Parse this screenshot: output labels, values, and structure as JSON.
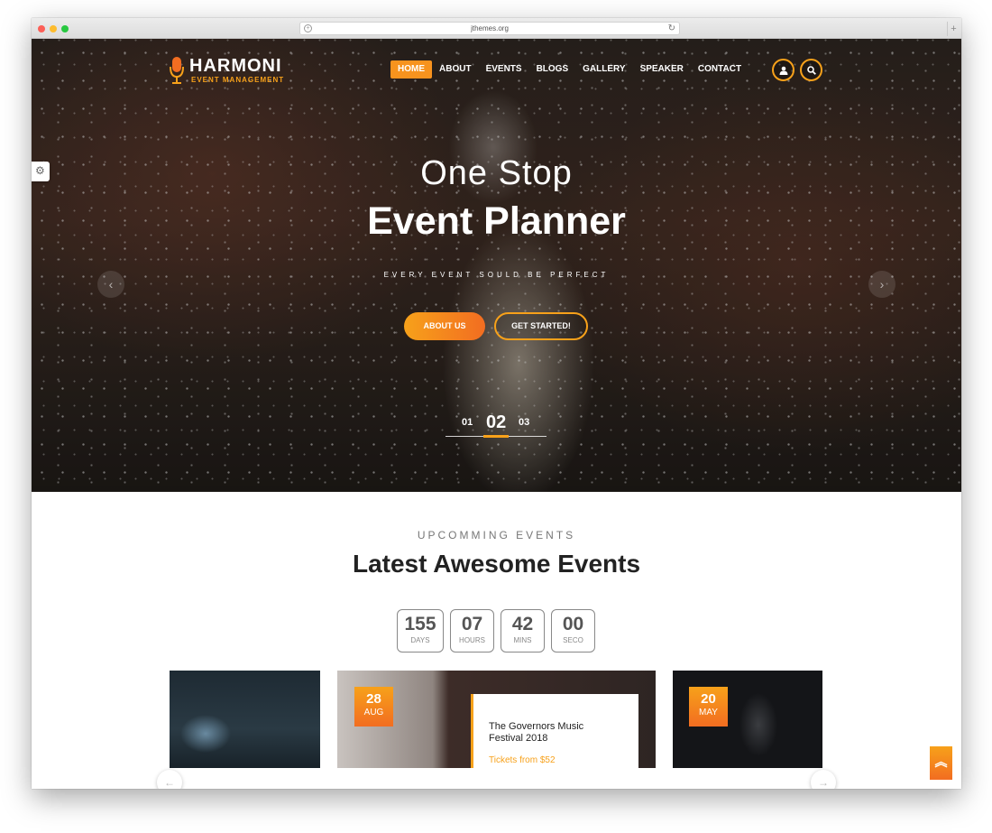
{
  "browser": {
    "url": "jthemes.org"
  },
  "brand": {
    "name": "HARMONI",
    "subtitle": "EVENT MANAGEMENT"
  },
  "nav": {
    "items": [
      {
        "label": "HOME",
        "active": true
      },
      {
        "label": "ABOUT",
        "active": false
      },
      {
        "label": "EVENTS",
        "active": false
      },
      {
        "label": "BLOGS",
        "active": false
      },
      {
        "label": "GALLERY",
        "active": false
      },
      {
        "label": "SPEAKER",
        "active": false
      },
      {
        "label": "CONTACT",
        "active": false
      }
    ]
  },
  "hero": {
    "title_line1": "One Stop",
    "title_line2": "Event Planner",
    "tagline": "EVERY EVENT SOULD BE PERFECT",
    "btn_about": "ABOUT US",
    "btn_start": "GET STARTED!",
    "slides": [
      "01",
      "02",
      "03"
    ],
    "active_slide": "02"
  },
  "events_section": {
    "subtitle": "UPCOMMING EVENTS",
    "title_light": "Latest",
    "title_bold": "Awesome Events"
  },
  "countdown": [
    {
      "value": "155",
      "label": "DAYS"
    },
    {
      "value": "07",
      "label": "HOURS"
    },
    {
      "value": "42",
      "label": "MINS"
    },
    {
      "value": "00",
      "label": "SECO"
    }
  ],
  "cards": [
    {
      "day": "28",
      "month": "AUG",
      "name": "The Governors Music Festival 2018",
      "price": "Tickets from $52"
    },
    {
      "day": "20",
      "month": "MAY"
    }
  ],
  "colors": {
    "accent": "#f7a11a",
    "accent_dark": "#f26d21"
  },
  "icons": {
    "user": "user-icon",
    "search": "search-icon",
    "settings": "gear-icon",
    "scroll_top": "double-chevron-up-icon"
  }
}
